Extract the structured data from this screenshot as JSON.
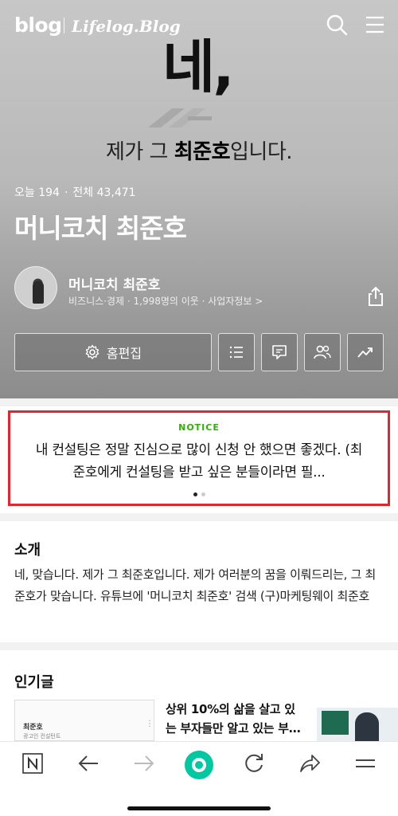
{
  "header": {
    "logo": "blog",
    "blog_name": "Lifelog.Blog",
    "icons": [
      "search-icon",
      "menu-icon"
    ]
  },
  "hero": {
    "big_text": "네,",
    "tagline_pre": "제가 그 ",
    "tagline_bold": "최준호",
    "tagline_post": "입니다."
  },
  "stats": {
    "today_label": "오늘 194",
    "total_label": "전체 43,471"
  },
  "blog_title": "머니코치 최준호",
  "owner": {
    "name": "머니코치 최준호",
    "meta": "비즈니스·경제 · 1,998명의 이웃 · 사업자정보 >"
  },
  "actions": {
    "home_edit_label": "홈편집",
    "icons": [
      "list-icon",
      "comment-icon",
      "neighbors-icon",
      "stats-icon"
    ]
  },
  "notice": {
    "tag": "NOTICE",
    "text": "내 컨설팅은 정말 진심으로 많이 신청 안 했으면 좋겠다. (최준호에게 컨설팅을 받고 싶은 분들이라면 필...",
    "pages": 2,
    "active_page": 1
  },
  "intro": {
    "heading": "소개",
    "text": "네, 맞습니다. 제가 그 최준호입니다. 제가 여러분의 꿈을 이뤄드리는, 그 최준호가 맞습니다. 유튜브에 '머니코치 최준호' 검색 (구)마케팅웨이 최준호"
  },
  "popular": {
    "heading": "인기글",
    "card1_name": "최준호",
    "card1_sub": "광고인 컨설턴트",
    "card2_title": "상위 10%의 삶을 살고 있는 부자들만 알고 있는 부…"
  },
  "bottom_nav": {
    "icons": [
      "n-home-icon",
      "back-arrow-icon",
      "forward-arrow-icon",
      "green-dot-icon",
      "refresh-icon",
      "share-arrow-icon",
      "hamburger-icon"
    ]
  },
  "colors": {
    "notice_border": "#e4242e",
    "notice_tag": "#2db400",
    "brand_green": "#00c73c"
  }
}
